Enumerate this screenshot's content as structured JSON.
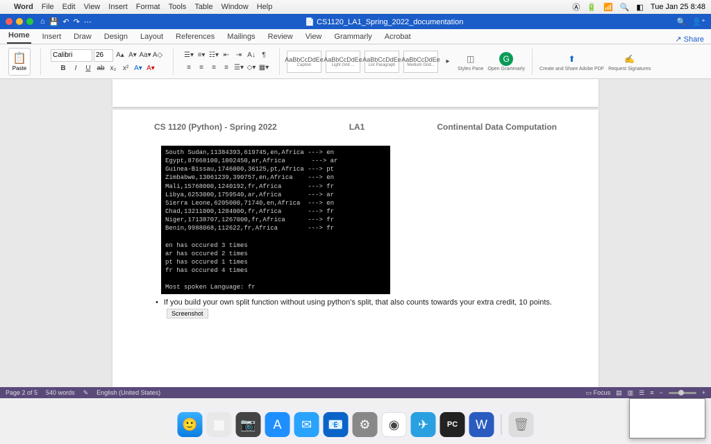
{
  "menubar": {
    "app": "Word",
    "items": [
      "File",
      "Edit",
      "View",
      "Insert",
      "Format",
      "Tools",
      "Table",
      "Window",
      "Help"
    ],
    "clock": "Tue Jan 25  8:48"
  },
  "window": {
    "title": "CS1120_LA1_Spring_2022_documentation",
    "doc_icon": "📄"
  },
  "tabs": {
    "items": [
      "Home",
      "Insert",
      "Draw",
      "Design",
      "Layout",
      "References",
      "Mailings",
      "Review",
      "View",
      "Grammarly",
      "Acrobat"
    ],
    "active": "Home",
    "share": "Share"
  },
  "ribbon": {
    "paste": "Paste",
    "font_name": "Calibri",
    "font_size": "26",
    "bold": "B",
    "italic": "I",
    "underline": "U",
    "strike": "ab",
    "sub": "x₂",
    "sup": "x²",
    "styles": [
      {
        "sample": "AaBbCcDdEe",
        "name": "Caption"
      },
      {
        "sample": "AaBbCcDdEe",
        "name": "Light Grid ..."
      },
      {
        "sample": "AaBbCcDdEe",
        "name": "List Paragraph"
      },
      {
        "sample": "AaBbCcDdEe",
        "name": "Medium Grid..."
      }
    ],
    "styles_pane": "Styles Pane",
    "grammarly": "Open Grammarly",
    "adobe": "Create and Share Adobe PDF",
    "signatures": "Request Signatures"
  },
  "doc": {
    "header_left": "CS 1120 (Python) - Spring 2022",
    "header_mid": "LA1",
    "header_right": "Continental Data Computation",
    "terminal": "South Sudan,11384393,619745,en,Africa ---> en\nEgypt,87668100,1002450,ar,Africa       ---> ar\nGuinea-Bissau,1746000,36125,pt,Africa ---> pt\nZimbabwe,13061239,390757,en,Africa    ---> en\nMali,15768000,1240192,fr,Africa       ---> fr\nLibya,6253000,1759540,ar,Africa       ---> ar\nSierra Leone,6205000,71740,en,Africa  ---> en\nChad,13211000,1284000,fr,Africa       ---> fr\nNiger,17138707,1267000,fr,Africa      ---> fr\nBenin,9988068,112622,fr,Africa        ---> fr\n\nen has occured 3 times\nar has occured 2 times\npt has occured 1 times\nfr has occured 4 times\n\nMost spoken Language: fr",
    "bullet": "If you build your own split function without using python's split, that also counts towards your extra credit, 10 points.",
    "screenshot_tag": "Screenshot"
  },
  "status": {
    "page": "Page 2 of 5",
    "words": "540 words",
    "lang": "English (United States)",
    "focus": "Focus"
  },
  "dock": {
    "pycharm": "PC"
  }
}
